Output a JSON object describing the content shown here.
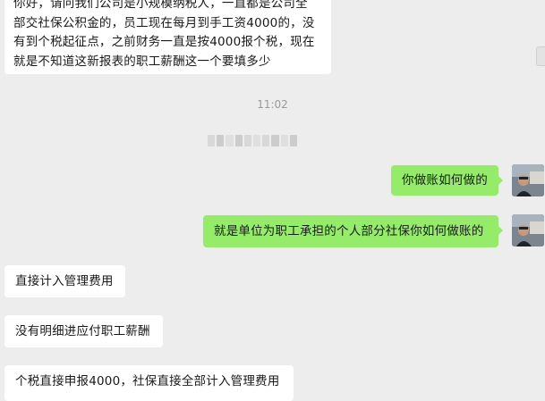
{
  "messages": {
    "m1": {
      "line1": "你好，请问我们公司是小规模纳税人，一直都是公司全",
      "line2": "部交社保公积金的，员工现在每月到手工资4000的，没",
      "line3": "有到个税起征点，之前财务一直是按4000报个税，现在",
      "line4": "就是不知道这新报表的职工薪酬这一个要填多少"
    },
    "m2": {
      "text": "你做账如何做的"
    },
    "m3": {
      "text": "就是单位为职工承担的个人部分社保你如何做账的"
    },
    "m4": {
      "text": "直接计入管理费用"
    },
    "m5": {
      "text": "没有明细进应付职工薪酬"
    },
    "m6": {
      "text": "个税直接申报4000，社保直接全部计入管理费用"
    }
  },
  "timestamp": "11:02",
  "colors": {
    "background": "#ededed",
    "incoming": "#ffffff",
    "outgoing": "#95ec69",
    "timestamp": "#9a9a9a"
  },
  "icons": {
    "avatar": "user-avatar-photo",
    "blurred_name": "mosaic-blur"
  }
}
